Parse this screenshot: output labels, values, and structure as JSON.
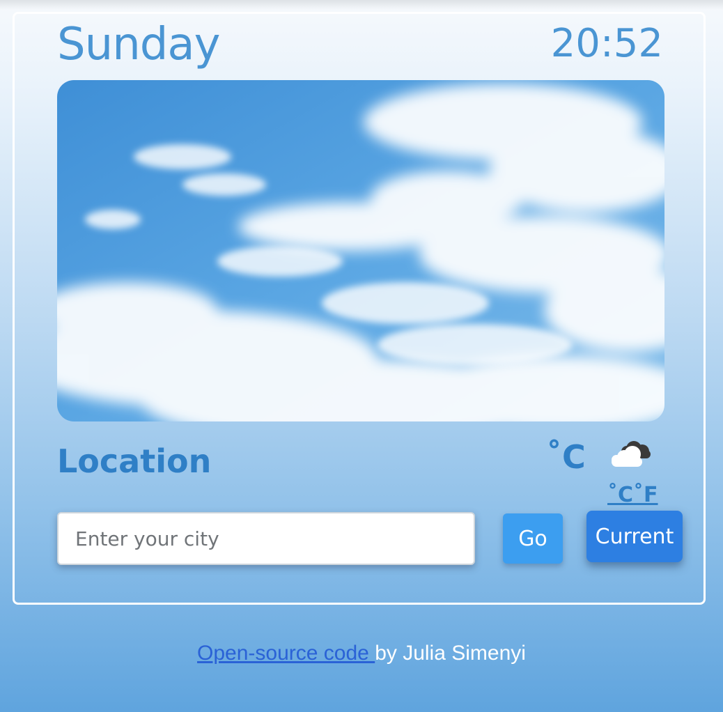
{
  "header": {
    "day": "Sunday",
    "time": "20:52"
  },
  "weather": {
    "location": "Location",
    "temperature_unit": "˚C",
    "icon": "cloud-moon-icon",
    "units": {
      "celsius": "˚C",
      "fahrenheit": "˚F"
    }
  },
  "search": {
    "placeholder": "Enter your city",
    "value": "",
    "go_label": "Go",
    "current_label": "Current"
  },
  "footer": {
    "link_text": "Open-source code ",
    "author_text": "by Julia Simenyi"
  },
  "colors": {
    "accent": "#4a95d3",
    "heading": "#2f7fc6",
    "go_button": "#3c9ef0",
    "current_button": "#2d7fe2",
    "link": "#2a62d6"
  }
}
